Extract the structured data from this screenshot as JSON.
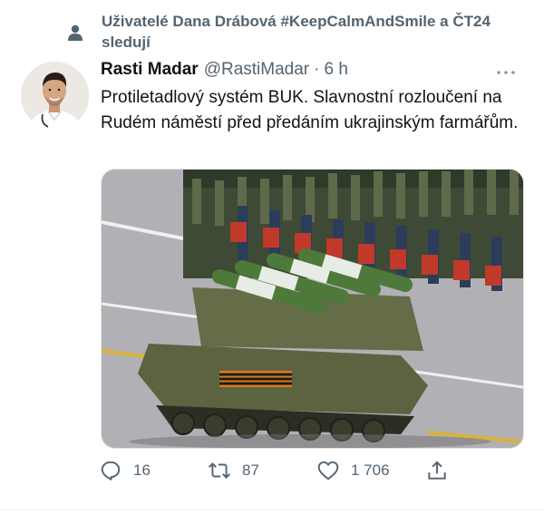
{
  "social_context": {
    "text": "Uživatelé Dana Drábová #KeepCalmAndSmile a ČT24 sledují",
    "icon": "person-icon"
  },
  "tweet": {
    "author_name": "Rasti Madar",
    "author_handle": "@RastiMadar",
    "separator": "·",
    "time": "6 h",
    "text": "Protiletadlový systém BUK. Slavnostní rozloučení na Rudém náměstí před předáním ukrajinským farmářům.",
    "media_description": "military-parade-photo"
  },
  "actions": {
    "reply_count": "16",
    "retweet_count": "87",
    "like_count": "1 706"
  },
  "colors": {
    "text": "#0f1419",
    "secondary": "#536471",
    "border": "#eff3f4"
  }
}
